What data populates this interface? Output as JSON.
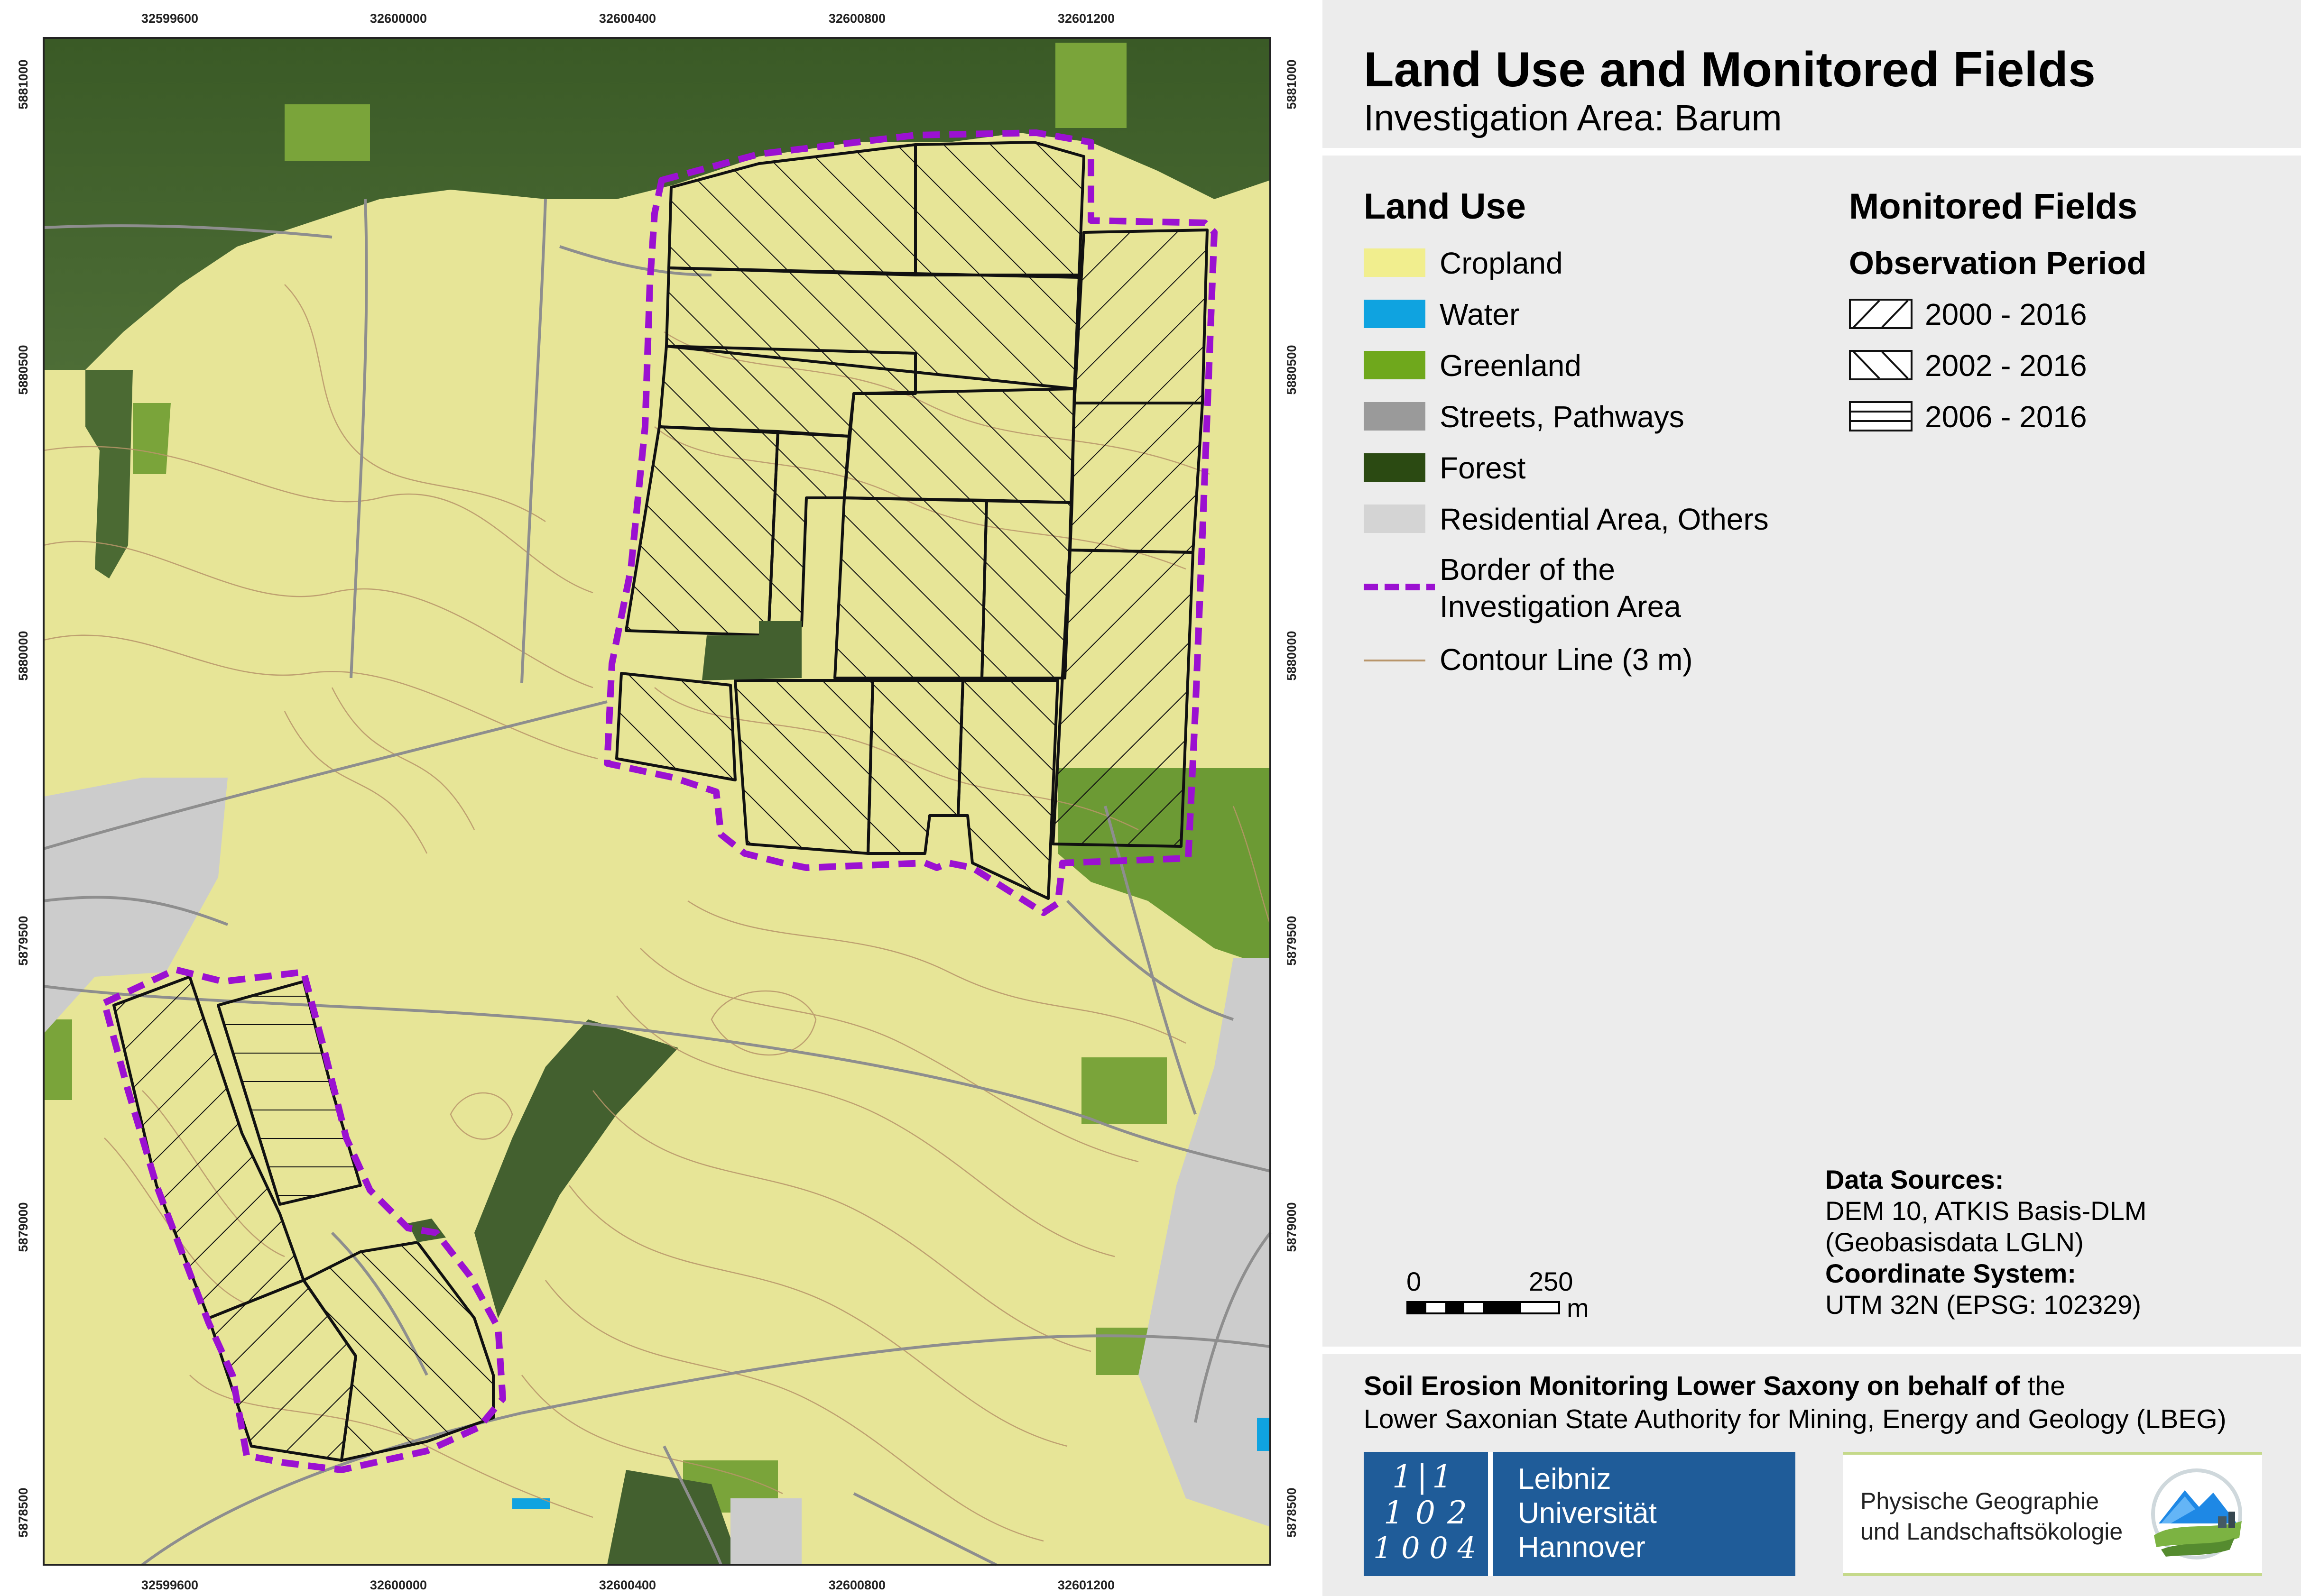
{
  "title": "Land Use and Monitored Fields",
  "subtitle": "Investigation Area: Barum",
  "colors": {
    "cropland": "#f1ee8e",
    "water": "#0fa3e0",
    "greenland": "#6fa81c",
    "streets": "#9a9a9a",
    "forest": "#2b4a12",
    "residential": "#d4d4d4",
    "border": "#9b11d1",
    "contour": "#b8956a",
    "map_cropland_shaded": "#e6e497",
    "map_forest": "#43602f",
    "map_greenland": "#78a03a",
    "map_residential": "#cccccc",
    "luh_blue": "#1f5c99"
  },
  "land_use": {
    "heading": "Land Use",
    "items": [
      {
        "label": "Cropland",
        "color_key": "cropland"
      },
      {
        "label": "Water",
        "color_key": "water"
      },
      {
        "label": "Greenland",
        "color_key": "greenland"
      },
      {
        "label": "Streets, Pathways",
        "color_key": "streets"
      },
      {
        "label": "Forest",
        "color_key": "forest"
      },
      {
        "label": "Residential Area, Others",
        "color_key": "residential"
      }
    ],
    "border_label_1": "Border of the",
    "border_label_2": "Investigation Area",
    "contour_label": "Contour Line (3 m)"
  },
  "monitored_fields": {
    "heading": "Monitored Fields",
    "subheading": "Observation Period",
    "items": [
      {
        "label": "2000 - 2016",
        "pattern": "hatch-forward"
      },
      {
        "label": "2002 - 2016",
        "pattern": "hatch-backward"
      },
      {
        "label": "2006 - 2016",
        "pattern": "hatch-horizontal"
      }
    ]
  },
  "axis_ticks": {
    "x": [
      "32599600",
      "32600000",
      "32600400",
      "32600800",
      "32601200"
    ],
    "y": [
      "5881000",
      "5880500",
      "5880000",
      "5879500",
      "5879000",
      "5878500"
    ]
  },
  "scale": {
    "start": "0",
    "end": "250",
    "unit": "m"
  },
  "data_sources": {
    "heading": "Data Sources:",
    "line1": "DEM 10, ATKIS Basis-DLM",
    "line2": "(Geobasisdata LGLN)",
    "crs_heading": "Coordinate System:",
    "crs": "UTM 32N (EPSG: 102329)"
  },
  "footer": {
    "bold": "Soil Erosion Monitoring Lower Saxony on behalf of",
    "normal1": " the",
    "line2": "Lower Saxonian State Authority for Mining, Energy and Geology (LBEG)"
  },
  "logos": {
    "luh_mark_rows": [
      "1|1",
      "1 0 2",
      "1 0 0 4"
    ],
    "luh_line1": "Leibniz",
    "luh_line2": "Universität",
    "luh_line3": "Hannover",
    "pg_line1": "Physische Geographie",
    "pg_line2": "und Landschaftsökologie"
  }
}
